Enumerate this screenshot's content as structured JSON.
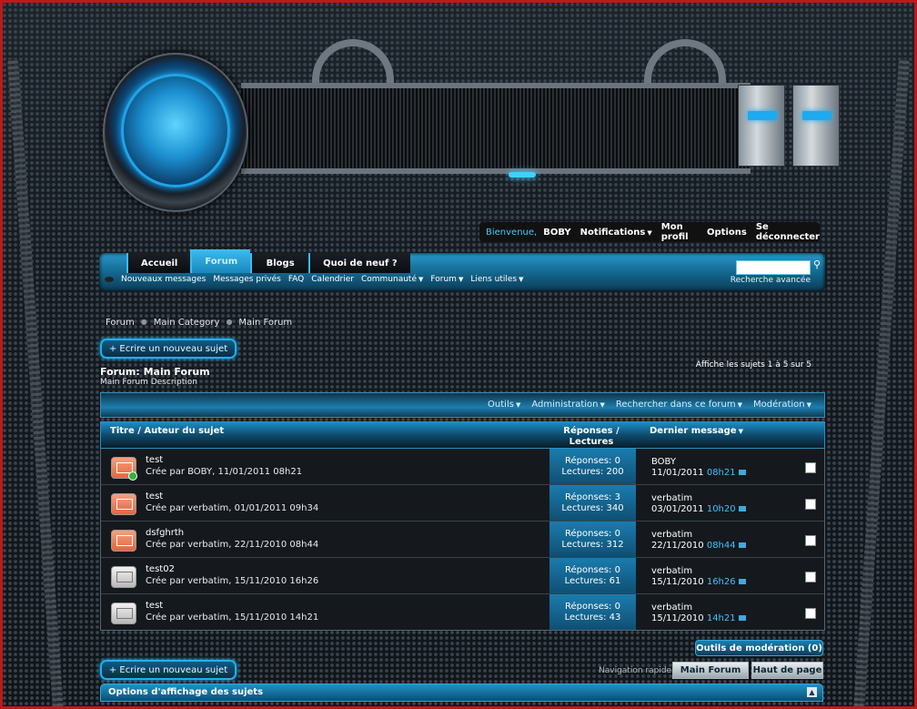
{
  "userbar": {
    "welcome": "Bienvenue,",
    "username": "BOBY",
    "notifications": "Notifications",
    "profile": "Mon profil",
    "options": "Options",
    "logout": "Se déconnecter"
  },
  "nav": {
    "tabs": [
      "Accueil",
      "Forum",
      "Blogs",
      "Quoi de neuf ?"
    ],
    "active_tab": "Forum",
    "subnav": [
      "Nouveaux messages",
      "Messages privés",
      "FAQ",
      "Calendrier",
      "Communauté",
      "Forum",
      "Liens utiles"
    ],
    "search_value": "",
    "advanced_search": "Recherche avancée"
  },
  "breadcrumb": [
    "Forum",
    "Main Category",
    "Main Forum"
  ],
  "new_thread_label": "+ Ecrire un nouveau sujet",
  "forum": {
    "title": "Forum: Main Forum",
    "description": "Main Forum Description",
    "pagination": "Affiche les sujets 1 à 5 sur 5"
  },
  "toolbar": [
    "Outils",
    "Administration",
    "Rechercher dans ce forum",
    "Modération"
  ],
  "columns": {
    "title": "Titre / Auteur du sujet",
    "replies": "Réponses / Lectures",
    "last": "Dernier message"
  },
  "threads": [
    {
      "title": "test",
      "meta": "Crée par BOBY, 11/01/2011 08h21",
      "replies": "Réponses: 0",
      "views": "Lectures: 200",
      "last_user": "BOBY",
      "last_date": "11/01/2011",
      "last_time": "08h21",
      "icon": "new",
      "online": true
    },
    {
      "title": "test",
      "meta": "Crée par verbatim, 01/01/2011 09h34",
      "replies": "Réponses: 3",
      "views": "Lectures: 340",
      "last_user": "verbatim",
      "last_date": "03/01/2011",
      "last_time": "10h20",
      "icon": "new",
      "online": false
    },
    {
      "title": "dsfghrth",
      "meta": "Crée par verbatim, 22/11/2010 08h44",
      "replies": "Réponses: 0",
      "views": "Lectures: 312",
      "last_user": "verbatim",
      "last_date": "22/11/2010",
      "last_time": "08h44",
      "icon": "new",
      "online": false
    },
    {
      "title": "test02",
      "meta": "Crée par verbatim, 15/11/2010 16h26",
      "replies": "Réponses: 0",
      "views": "Lectures: 61",
      "last_user": "verbatim",
      "last_date": "15/11/2010",
      "last_time": "16h26",
      "icon": "old",
      "online": false
    },
    {
      "title": "test",
      "meta": "Crée par verbatim, 15/11/2010 14h21",
      "replies": "Réponses: 0",
      "views": "Lectures: 43",
      "last_user": "verbatim",
      "last_date": "15/11/2010",
      "last_time": "14h21",
      "icon": "old",
      "online": false
    }
  ],
  "moderation_tools": "Outils de modération (0)",
  "quick_nav": {
    "label": "Navigation rapide",
    "main_forum": "Main Forum",
    "top": "Haut de page"
  },
  "display_options": "Options d'affichage des sujets",
  "colors": {
    "accent": "#1fb0ec",
    "frame": "#c01818"
  }
}
